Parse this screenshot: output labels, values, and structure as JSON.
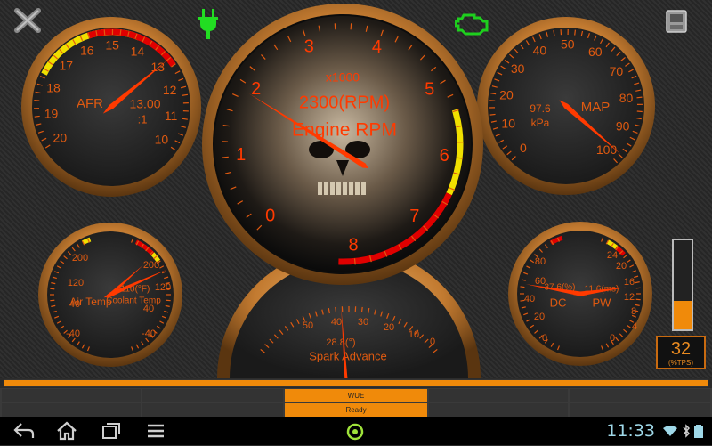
{
  "colors": {
    "accent": "#f08a0a",
    "needle": "#ff3a00",
    "plug": "#22dd22",
    "engine": "#1ecf1e",
    "tick": "#e05a10",
    "yellow": "#f0e000",
    "red": "#e00000",
    "cyan": "#9fd8e8"
  },
  "icons": {
    "settings": "tools-icon",
    "connection": "plug-icon",
    "check_engine": "engine-icon",
    "dashboard": "dashboard-icon"
  },
  "gauges": {
    "afr": {
      "title": "AFR",
      "value_text": "13.00",
      "value_sub": ":1",
      "ticks": [
        "10",
        "11",
        "12",
        "13",
        "14",
        "15",
        "16",
        "17",
        "18",
        "19",
        "20"
      ],
      "value": 13.0
    },
    "rpm": {
      "title": "Engine RPM",
      "multiplier": "x1000",
      "value_text": "2300(RPM)",
      "ticks": [
        "0",
        "1",
        "2",
        "3",
        "4",
        "5",
        "6",
        "7",
        "8"
      ],
      "value": 2.3
    },
    "map": {
      "title": "MAP",
      "value_text": "97.6",
      "unit": "kPa",
      "ticks": [
        "0",
        "10",
        "20",
        "30",
        "40",
        "50",
        "60",
        "70",
        "80",
        "90",
        "100"
      ],
      "value": 97.6
    },
    "temp": {
      "label_air": "Air Temp",
      "label_coolant": "Coolant Temp",
      "value_text": "110(°F)",
      "ticks_left": [
        "-40",
        "40",
        "120",
        "200"
      ],
      "ticks_right": [
        "-40",
        "40",
        "120",
        "200"
      ],
      "air_value": 97,
      "coolant_value": 110
    },
    "spark": {
      "title": "Spark Advance",
      "value_text": "28.8(°)",
      "ticks": [
        "50",
        "40",
        "30",
        "20",
        "10",
        "0"
      ],
      "value": 28.8
    },
    "dc_pw": {
      "label_dc": "DC",
      "label_pw": "PW",
      "dc_text": "37.6(%)",
      "pw_text": "11.6(ms)",
      "ticks_left": [
        "0",
        "20",
        "40",
        "60",
        "80"
      ],
      "ticks_right": [
        "0",
        "4",
        "8",
        "12",
        "16",
        "20",
        "24"
      ],
      "dc_value": 37.6,
      "pw_value": 11.6
    }
  },
  "tps": {
    "value": "32",
    "unit": "(%TPS)",
    "fraction": 0.32
  },
  "status": {
    "wue": "WUE",
    "ready": "Ready"
  },
  "clock": "11:33"
}
